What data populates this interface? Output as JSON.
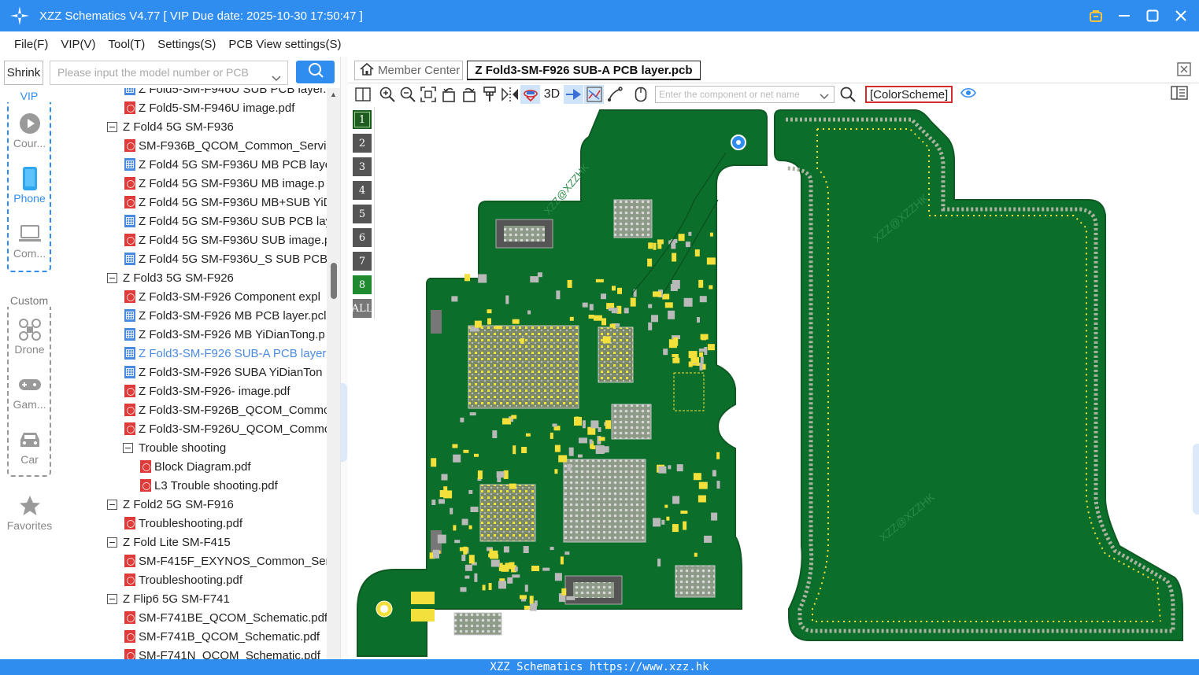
{
  "window": {
    "title": "XZZ Schematics V4.77 [ VIP Due date: 2025-10-30 17:50:47 ]"
  },
  "menu": [
    "File(F)",
    "VIP(V)",
    "Tool(T)",
    "Settings(S)",
    "PCB View settings(S)"
  ],
  "search": {
    "shrink_label": "Shrink",
    "placeholder": "Please input the model number or PCB"
  },
  "nav": {
    "vip_label": "VIP",
    "custom_label": "Custom",
    "items": [
      {
        "label": "Cour...",
        "icon": "play-icon"
      },
      {
        "label": "Phone",
        "icon": "phone-icon"
      },
      {
        "label": "Com...",
        "icon": "laptop-icon"
      },
      {
        "label": "Drone",
        "icon": "drone-icon"
      },
      {
        "label": "Gam...",
        "icon": "gamepad-icon"
      },
      {
        "label": "Car",
        "icon": "car-icon"
      },
      {
        "label": "Favorites",
        "icon": "star-icon"
      }
    ]
  },
  "tree": [
    {
      "level": 1,
      "type": "pcb",
      "label": "Z Fold5-SM-F946U SUB PCB layer.p"
    },
    {
      "level": 1,
      "type": "pdf",
      "label": "Z Fold5-SM-F946U image.pdf"
    },
    {
      "level": 0,
      "type": "folder",
      "label": "Z Fold4 5G SM-F936"
    },
    {
      "level": 1,
      "type": "pdf",
      "label": "SM-F936B_QCOM_Common_Servic"
    },
    {
      "level": 1,
      "type": "pcb",
      "label": "Z Fold4 5G SM-F936U MB PCB laye"
    },
    {
      "level": 1,
      "type": "pdf",
      "label": "Z Fold4 5G SM-F936U MB image.p"
    },
    {
      "level": 1,
      "type": "pdf",
      "label": "Z Fold4 5G SM-F936U MB+SUB YiD"
    },
    {
      "level": 1,
      "type": "pcb",
      "label": "Z Fold4 5G SM-F936U SUB PCB lay"
    },
    {
      "level": 1,
      "type": "pdf",
      "label": "Z Fold4 5G SM-F936U SUB image.p"
    },
    {
      "level": 1,
      "type": "pcb",
      "label": "Z Fold4 5G SM-F936U_S SUB PCB l"
    },
    {
      "level": 0,
      "type": "folder",
      "label": "Z Fold3 5G SM-F926"
    },
    {
      "level": 1,
      "type": "pdf",
      "label": "Z Fold3-SM-F926 Component expl"
    },
    {
      "level": 1,
      "type": "pcb",
      "label": "Z Fold3-SM-F926 MB PCB layer.pcl"
    },
    {
      "level": 1,
      "type": "pcb",
      "label": "Z Fold3-SM-F926 MB YiDianTong.p"
    },
    {
      "level": 1,
      "type": "pcb",
      "label": "Z Fold3-SM-F926 SUB-A PCB layer.",
      "selected": true
    },
    {
      "level": 1,
      "type": "pcb",
      "label": "Z Fold3-SM-F926 SUBA YiDianTon"
    },
    {
      "level": 1,
      "type": "pdf",
      "label": "Z Fold3-SM-F926- image.pdf"
    },
    {
      "level": 1,
      "type": "pdf",
      "label": "Z Fold3-SM-F926B_QCOM_Commc"
    },
    {
      "level": 1,
      "type": "pdf",
      "label": "Z Fold3-SM-F926U_QCOM_Commc"
    },
    {
      "level": 1,
      "type": "folder",
      "label": "Trouble shooting"
    },
    {
      "level": 2,
      "type": "pdf",
      "label": "Block Diagram.pdf"
    },
    {
      "level": 2,
      "type": "pdf",
      "label": "L3 Trouble shooting.pdf"
    },
    {
      "level": 0,
      "type": "folder",
      "label": "Z Fold2 5G SM-F916"
    },
    {
      "level": 1,
      "type": "pdf",
      "label": "Troubleshooting.pdf"
    },
    {
      "level": 0,
      "type": "folder",
      "label": "Z Fold Lite SM-F415"
    },
    {
      "level": 1,
      "type": "pdf",
      "label": "SM-F415F_EXYNOS_Common_Servi"
    },
    {
      "level": 1,
      "type": "pdf",
      "label": "Troubleshooting.pdf"
    },
    {
      "level": 0,
      "type": "folder",
      "label": "Z Flip6 5G SM-F741"
    },
    {
      "level": 1,
      "type": "pdf",
      "label": "SM-F741BE_QCOM_Schematic.pdf"
    },
    {
      "level": 1,
      "type": "pdf",
      "label": "SM-F741B_QCOM_Schematic.pdf"
    },
    {
      "level": 1,
      "type": "pdf",
      "label": "SM-F741N_QCOM_Schematic.pdf"
    }
  ],
  "tabs": {
    "member_center": "Member Center",
    "active_file": "Z Fold3-SM-F926 SUB-A PCB layer.pcb"
  },
  "toolbar": {
    "label_3d": "3D",
    "component_placeholder": "Enter the component or net name",
    "color_scheme": "[ColorScheme]"
  },
  "layers": [
    "1",
    "2",
    "3",
    "4",
    "5",
    "6",
    "7",
    "8",
    "ALL"
  ],
  "pcb": {
    "watermark": "XZZ@XZZHK",
    "board_color": "#0b6e2a",
    "pad_color": "#f3e03a"
  },
  "status": "XZZ Schematics https://www.xzz.hk",
  "colors": {
    "accent": "#2f8df0",
    "selected_item": "#4a8be0"
  }
}
